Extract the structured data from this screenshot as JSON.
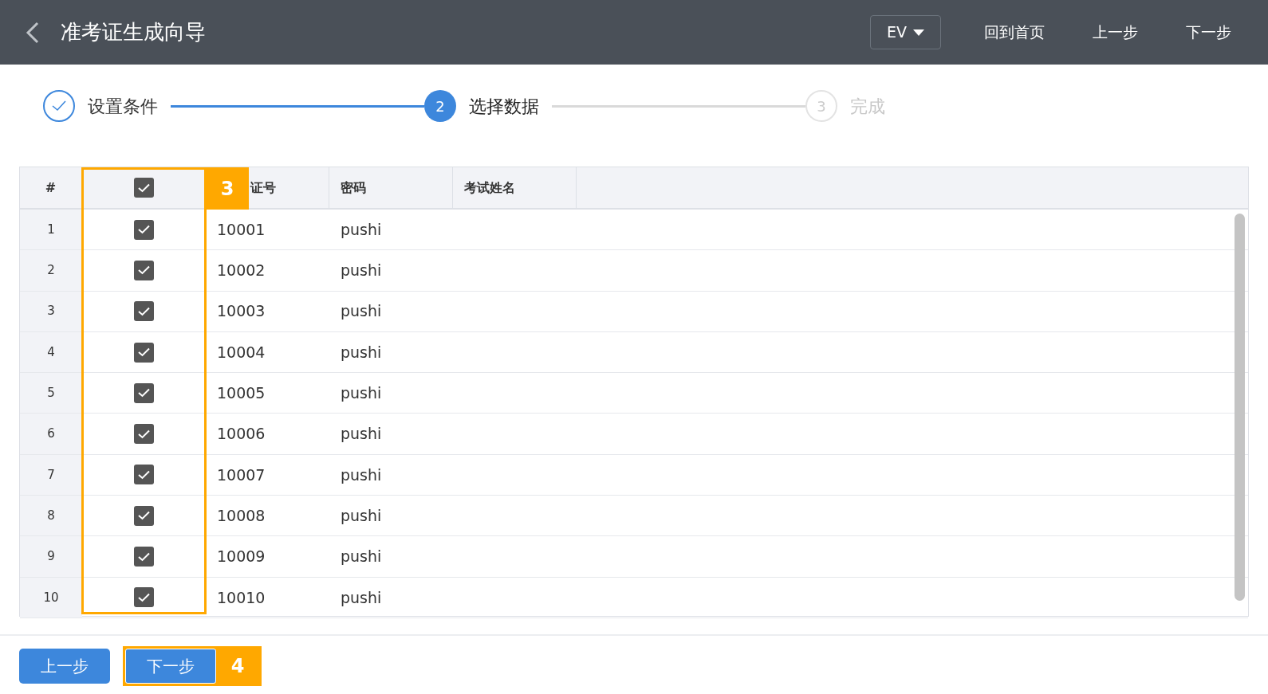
{
  "header": {
    "title": "准考证生成向导",
    "dropdown": "EV",
    "links": [
      "回到首页",
      "上一步",
      "下一步"
    ]
  },
  "steps": [
    {
      "label": "设置条件",
      "completed": true,
      "selected": false
    },
    {
      "number": "2",
      "label": "选择数据",
      "completed": false,
      "selected": true
    },
    {
      "number": "3",
      "label": "完成",
      "completed": false,
      "selected": false
    }
  ],
  "table": {
    "columns": [
      "#",
      "证号",
      "密码",
      "考试姓名"
    ],
    "select_all_checked": true,
    "rows": [
      {
        "index": "1",
        "checked": true,
        "id": "10001",
        "password": "pushi"
      },
      {
        "index": "2",
        "checked": true,
        "id": "10002",
        "password": "pushi"
      },
      {
        "index": "3",
        "checked": true,
        "id": "10003",
        "password": "pushi"
      },
      {
        "index": "4",
        "checked": true,
        "id": "10004",
        "password": "pushi"
      },
      {
        "index": "5",
        "checked": true,
        "id": "10005",
        "password": "pushi"
      },
      {
        "index": "6",
        "checked": true,
        "id": "10006",
        "password": "pushi"
      },
      {
        "index": "7",
        "checked": true,
        "id": "10007",
        "password": "pushi"
      },
      {
        "index": "8",
        "checked": true,
        "id": "10008",
        "password": "pushi"
      },
      {
        "index": "9",
        "checked": true,
        "id": "10009",
        "password": "pushi"
      },
      {
        "index": "10",
        "checked": true,
        "id": "10010",
        "password": "pushi"
      }
    ]
  },
  "footer_buttons": [
    "上一步",
    "下一步"
  ],
  "annotations": [
    "3",
    "4"
  ]
}
